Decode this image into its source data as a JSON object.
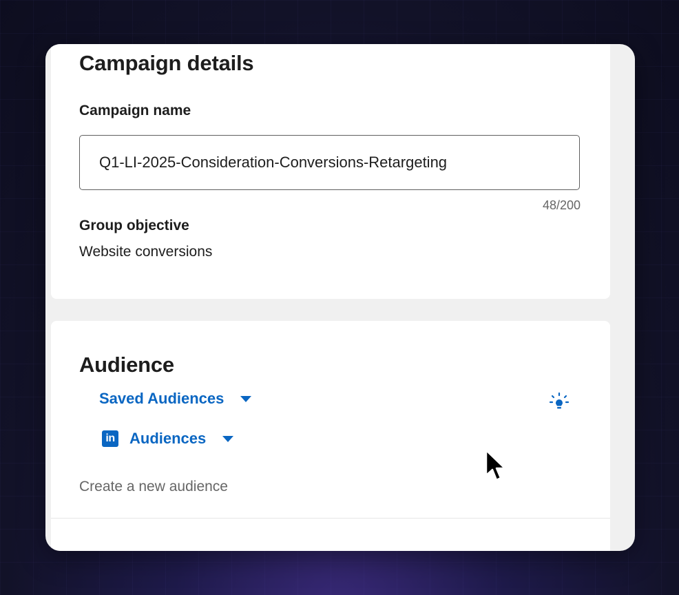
{
  "campaign_details": {
    "title": "Campaign details",
    "name_label": "Campaign name",
    "name_value": "Q1-LI-2025-Consideration-Conversions-Retargeting",
    "counter": "48/200",
    "objective_label": "Group objective",
    "objective_value": "Website conversions"
  },
  "audience": {
    "title": "Audience",
    "saved_audiences_label": "Saved Audiences",
    "audiences_label": "Audiences",
    "create_new_label": "Create a new audience"
  },
  "icons": {
    "saved_caret": "chevron-down-icon",
    "audiences_caret": "chevron-down-icon",
    "linkedin": "linkedin-icon",
    "bulb": "lightbulb-icon",
    "cursor": "mouse-pointer-icon"
  },
  "colors": {
    "accent": "#0a66c2",
    "text": "#1d1d1d",
    "muted": "#666666"
  }
}
